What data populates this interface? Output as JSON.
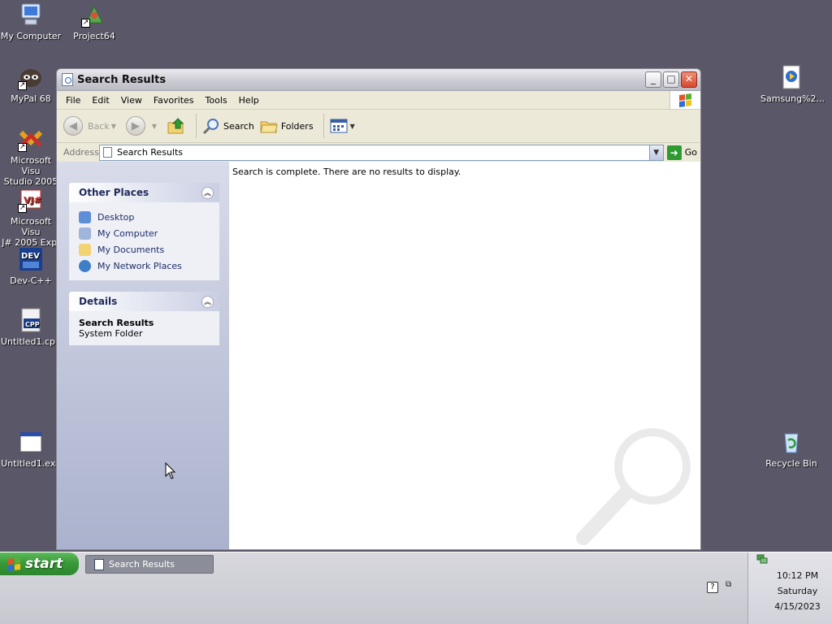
{
  "desktop": {
    "icons": [
      {
        "label": "My Computer",
        "icon": "computer-icon"
      },
      {
        "label": "Project64",
        "icon": "project64-icon"
      },
      {
        "label": "MyPal 68",
        "icon": "mypal-icon"
      },
      {
        "label": "Microsoft Visu\nStudio 2005",
        "icon": "visual-studio-icon"
      },
      {
        "label": "Microsoft Visu\nJ# 2005 Exp.",
        "icon": "vj-sharp-icon"
      },
      {
        "label": "Dev-C++",
        "icon": "dev-cpp-icon"
      },
      {
        "label": "Untitled1.cpp",
        "icon": "cpp-file-icon"
      },
      {
        "label": "Untitled1.exe",
        "icon": "exe-file-icon"
      },
      {
        "label": "Samsung%2...",
        "icon": "media-file-icon"
      },
      {
        "label": "Recycle Bin",
        "icon": "recycle-bin-icon"
      }
    ]
  },
  "window": {
    "title": "Search Results",
    "controls": {
      "minimize": "_",
      "maximize": "□",
      "close": "✕"
    },
    "menu": [
      "File",
      "Edit",
      "View",
      "Favorites",
      "Tools",
      "Help"
    ],
    "toolbar": {
      "back": "Back",
      "search": "Search",
      "folders": "Folders"
    },
    "address": {
      "label": "Address",
      "value": "Search Results",
      "go": "Go"
    },
    "sidepane": {
      "other_places": {
        "title": "Other Places",
        "links": [
          "Desktop",
          "My Computer",
          "My Documents",
          "My Network Places"
        ]
      },
      "details": {
        "title": "Details",
        "name": "Search Results",
        "type": "System Folder"
      }
    },
    "main": {
      "message": "Search is complete. There are no results to display."
    }
  },
  "taskbar": {
    "start_label": "start",
    "items": [
      {
        "label": "Search Results"
      }
    ],
    "clock": {
      "time": "10:12 PM",
      "day": "Saturday",
      "date": "4/15/2023"
    }
  },
  "colors": {
    "desktop_bg": "#5a5868",
    "start_green": "#3a9a3a",
    "link_blue": "#1e2d68"
  }
}
